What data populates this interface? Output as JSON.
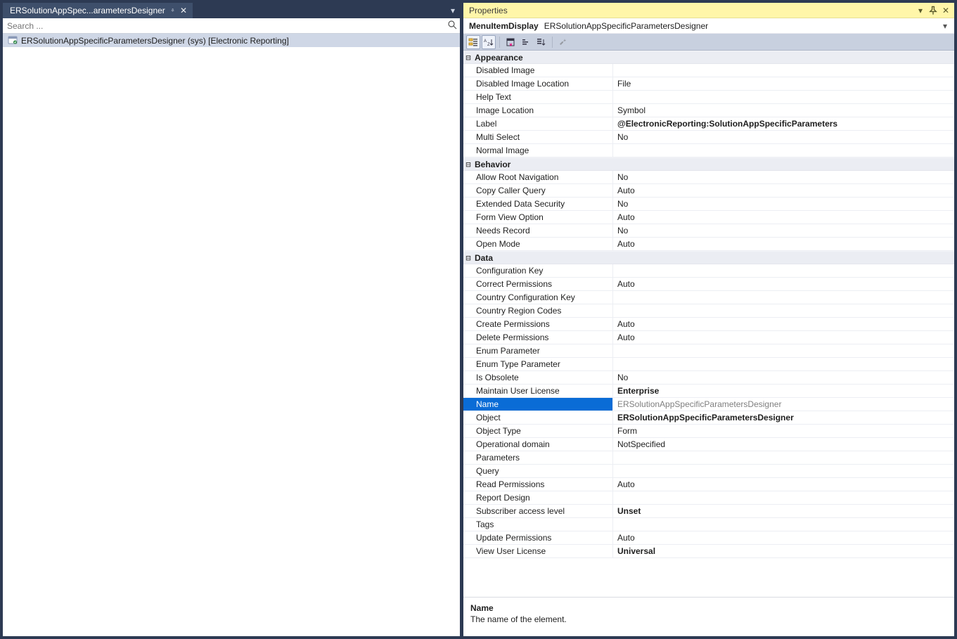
{
  "left": {
    "tab_label": "ERSolutionAppSpec...arametersDesigner",
    "search_placeholder": "Search ...",
    "tree_item": "ERSolutionAppSpecificParametersDesigner (sys) [Electronic Reporting]"
  },
  "panel": {
    "title": "Properties",
    "type_kind": "MenuItemDisplay",
    "type_name": "ERSolutionAppSpecificParametersDesigner"
  },
  "toolbar_icons": [
    "categorized-icon",
    "alphabetical-icon",
    "propertypages-icon",
    "extensions-icon",
    "events-icon",
    "wrench-icon"
  ],
  "categories": [
    {
      "name": "Appearance",
      "items": [
        {
          "name": "Disabled Image",
          "value": ""
        },
        {
          "name": "Disabled Image Location",
          "value": "File"
        },
        {
          "name": "Help Text",
          "value": ""
        },
        {
          "name": "Image Location",
          "value": "Symbol"
        },
        {
          "name": "Label",
          "value": "@ElectronicReporting:SolutionAppSpecificParameters",
          "bold": true
        },
        {
          "name": "Multi Select",
          "value": "No"
        },
        {
          "name": "Normal Image",
          "value": ""
        }
      ]
    },
    {
      "name": "Behavior",
      "items": [
        {
          "name": "Allow Root Navigation",
          "value": "No"
        },
        {
          "name": "Copy Caller Query",
          "value": "Auto"
        },
        {
          "name": "Extended Data Security",
          "value": "No"
        },
        {
          "name": "Form View Option",
          "value": "Auto"
        },
        {
          "name": "Needs Record",
          "value": "No"
        },
        {
          "name": "Open Mode",
          "value": "Auto"
        }
      ]
    },
    {
      "name": "Data",
      "items": [
        {
          "name": "Configuration Key",
          "value": ""
        },
        {
          "name": "Correct Permissions",
          "value": "Auto"
        },
        {
          "name": "Country Configuration Key",
          "value": ""
        },
        {
          "name": "Country Region Codes",
          "value": ""
        },
        {
          "name": "Create Permissions",
          "value": "Auto"
        },
        {
          "name": "Delete Permissions",
          "value": "Auto"
        },
        {
          "name": "Enum Parameter",
          "value": ""
        },
        {
          "name": "Enum Type Parameter",
          "value": ""
        },
        {
          "name": "Is Obsolete",
          "value": "No"
        },
        {
          "name": "Maintain User License",
          "value": "Enterprise",
          "bold": true
        },
        {
          "name": "Name",
          "value": "ERSolutionAppSpecificParametersDesigner",
          "selected": true
        },
        {
          "name": "Object",
          "value": "ERSolutionAppSpecificParametersDesigner",
          "bold": true
        },
        {
          "name": "Object Type",
          "value": "Form"
        },
        {
          "name": "Operational domain",
          "value": "NotSpecified"
        },
        {
          "name": "Parameters",
          "value": ""
        },
        {
          "name": "Query",
          "value": ""
        },
        {
          "name": "Read Permissions",
          "value": "Auto"
        },
        {
          "name": "Report Design",
          "value": ""
        },
        {
          "name": "Subscriber access level",
          "value": "Unset",
          "bold": true
        },
        {
          "name": "Tags",
          "value": ""
        },
        {
          "name": "Update Permissions",
          "value": "Auto"
        },
        {
          "name": "View User License",
          "value": "Universal",
          "bold": true
        }
      ]
    }
  ],
  "description": {
    "name": "Name",
    "text": "The name of the element."
  }
}
